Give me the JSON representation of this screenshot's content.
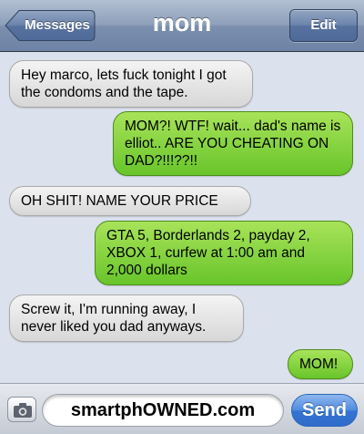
{
  "navbar": {
    "title": "mom",
    "back_label": "Messages",
    "edit_label": "Edit"
  },
  "messages": [
    {
      "direction": "incoming",
      "text": "Hey marco, lets fuck tonight I got the condoms and the tape."
    },
    {
      "direction": "outgoing",
      "text": "MOM?! WTF! wait... dad's name is elliot.. ARE YOU CHEATING ON DAD?!!!??!!"
    },
    {
      "direction": "incoming",
      "text": "OH SHIT! NAME YOUR PRICE"
    },
    {
      "direction": "outgoing",
      "text": "GTA 5, Borderlands 2, payday 2, XBOX 1, curfew at 1:00 am and 2,000 dollars"
    },
    {
      "direction": "incoming",
      "text": "Screw it, I'm running away, I never liked you dad anyways."
    },
    {
      "direction": "outgoing",
      "text": "MOM!"
    }
  ],
  "input_bar": {
    "field_text": "smartphOWNED.com",
    "send_label": "Send",
    "camera_icon": "camera-icon"
  },
  "colors": {
    "incoming_bubble": "#e8e8e8",
    "outgoing_bubble": "#7dd13a",
    "background": "#dbe2ed",
    "send_button": "#3574d4"
  }
}
